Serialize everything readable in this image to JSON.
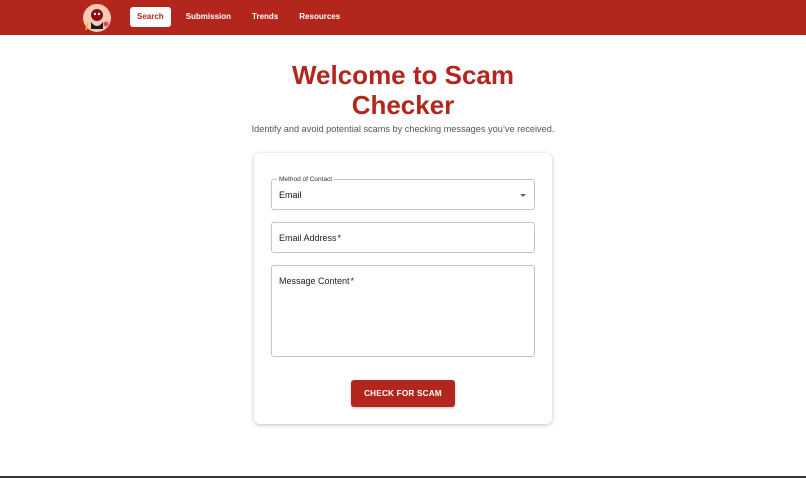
{
  "nav": {
    "items": [
      {
        "label": "Search",
        "active": true
      },
      {
        "label": "Submission",
        "active": false
      },
      {
        "label": "Trends",
        "active": false
      },
      {
        "label": "Resources",
        "active": false
      }
    ]
  },
  "hero": {
    "title_line1": "Welcome to Scam",
    "title_line2": "Checker",
    "subtitle": "Identify and avoid potential scams by checking messages you’ve received."
  },
  "form": {
    "method_label": "Method of Contact",
    "method_value": "Email",
    "email_label": "Email Address",
    "message_label": "Message Content",
    "required_mark": "*",
    "submit_label": "CHECK FOR SCAM"
  },
  "colors": {
    "brand": "#b3261e",
    "text": "#111111",
    "muted": "#555555"
  },
  "icons": {
    "logo": "devil-mascot-icon",
    "dropdown": "caret-down-icon"
  }
}
